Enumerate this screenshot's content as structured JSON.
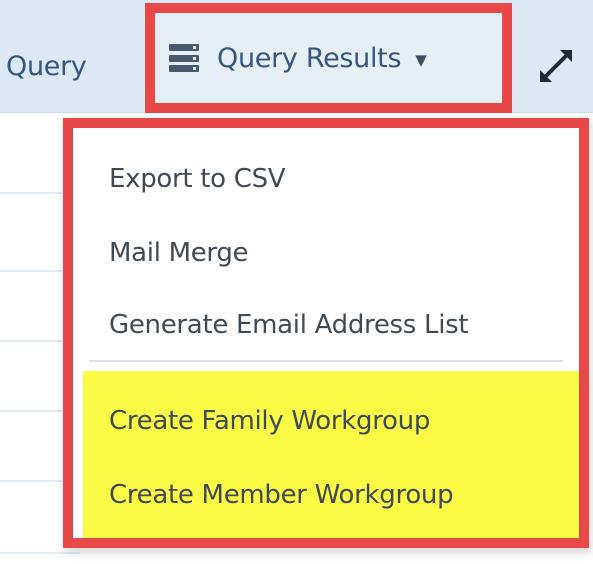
{
  "toolbar": {
    "query_tab_label": "Query",
    "results_button_label": "Query Results",
    "results_caret": "▼"
  },
  "menu": {
    "items": [
      {
        "label": "Export to CSV"
      },
      {
        "label": "Mail Merge"
      },
      {
        "label": "Generate Email Address List"
      },
      {
        "label": "Create Family Workgroup"
      },
      {
        "label": "Create Member Workgroup"
      }
    ]
  },
  "colors": {
    "highlight_outline": "#e84848",
    "highlight_fill": "#fbfb45",
    "toolbar_bg": "#dce9f5",
    "link_text": "#35577f"
  },
  "icons": {
    "results_icon": "database-icon",
    "expand_icon": "expand-icon",
    "dropdown_icon": "caret-down-icon"
  }
}
